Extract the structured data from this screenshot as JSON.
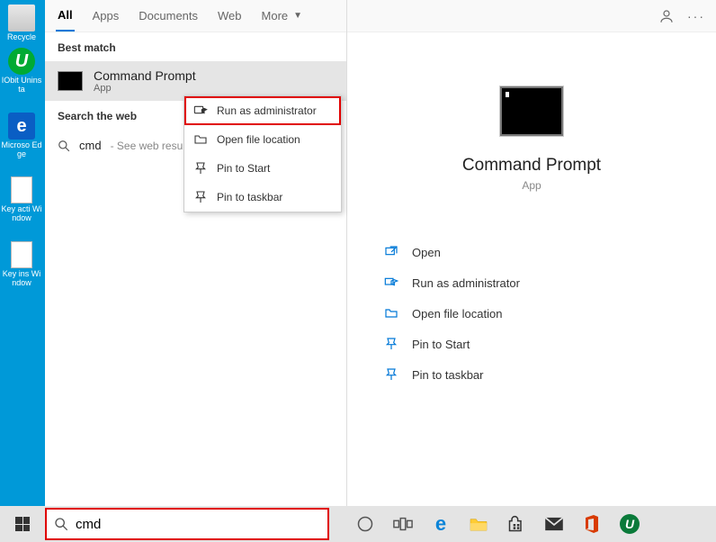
{
  "desktop": {
    "recycle": "Recycle",
    "iobit": "IObit Uninsta",
    "edge": "Microso Edge",
    "key_act": "Key acti Window",
    "key_ins": "Key ins Window"
  },
  "tabs": {
    "all": "All",
    "apps": "Apps",
    "documents": "Documents",
    "web": "Web",
    "more": "More"
  },
  "search": {
    "best_match": "Best match",
    "result_title": "Command Prompt",
    "result_sub": "App",
    "web_label": "Search the web",
    "web_query": "cmd",
    "web_hint": "- See web resul",
    "input_value": "cmd"
  },
  "context": {
    "run_admin": "Run as administrator",
    "open_loc": "Open file location",
    "pin_start": "Pin to Start",
    "pin_taskbar": "Pin to taskbar"
  },
  "detail": {
    "title": "Command Prompt",
    "sub": "App",
    "open": "Open",
    "run_admin": "Run as administrator",
    "open_loc": "Open file location",
    "pin_start": "Pin to Start",
    "pin_taskbar": "Pin to taskbar"
  }
}
